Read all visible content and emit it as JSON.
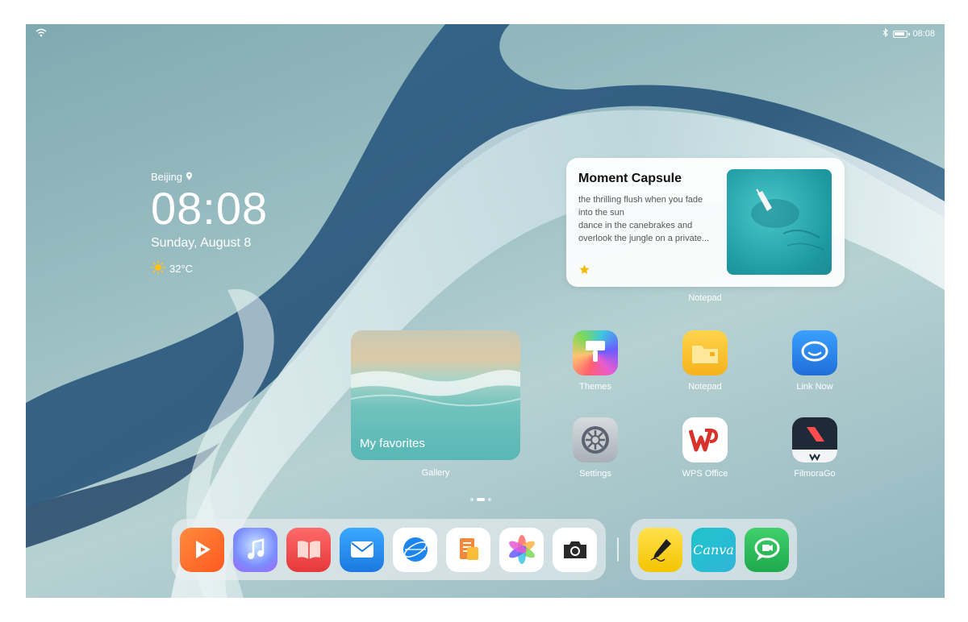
{
  "status_bar": {
    "time": "08:08",
    "wifi_icon": "wifi-icon",
    "bluetooth_icon": "bluetooth-icon",
    "battery_icon": "battery-icon"
  },
  "clock_widget": {
    "city": "Beijing",
    "time": "08:08",
    "date": "Sunday, August 8",
    "temperature": "32°C",
    "weather_icon": "sun-icon"
  },
  "moment_capsule": {
    "title": "Moment Capsule",
    "lines": [
      "the thrilling flush when you fade",
      "into the sun",
      "dance in the canebrakes and",
      "overlook the jungle on a private..."
    ],
    "label": "Notepad",
    "star_color": "#f5b800"
  },
  "gallery_widget": {
    "title": "My favorites",
    "label": "Gallery"
  },
  "apps": [
    {
      "label": "Themes",
      "icon": "themes-brush-icon"
    },
    {
      "label": "Notepad",
      "icon": "notepad-folder-icon"
    },
    {
      "label": "Link Now",
      "icon": "link-now-chat-icon"
    },
    {
      "label": "Settings",
      "icon": "settings-gear-icon"
    },
    {
      "label": "WPS Office",
      "icon": "wps-office-icon"
    },
    {
      "label": "FilmoraGo",
      "icon": "filmorago-icon"
    }
  ],
  "dock_icons": [
    "video-icon",
    "music-icon",
    "books-icon",
    "email-icon",
    "browser-icon",
    "docs-icon",
    "photos-icon",
    "camera-icon"
  ],
  "dock_secondary_icons": [
    {
      "icon": "notes-pen-icon"
    },
    {
      "icon": "canva-icon",
      "text": "Canva"
    },
    {
      "icon": "meetime-icon"
    }
  ],
  "colors": {
    "accent_blue": "#1f6fd8",
    "wps_red": "#d8322c",
    "canva_teal": "#27c3c9",
    "meetime_green": "#2fc25b"
  }
}
